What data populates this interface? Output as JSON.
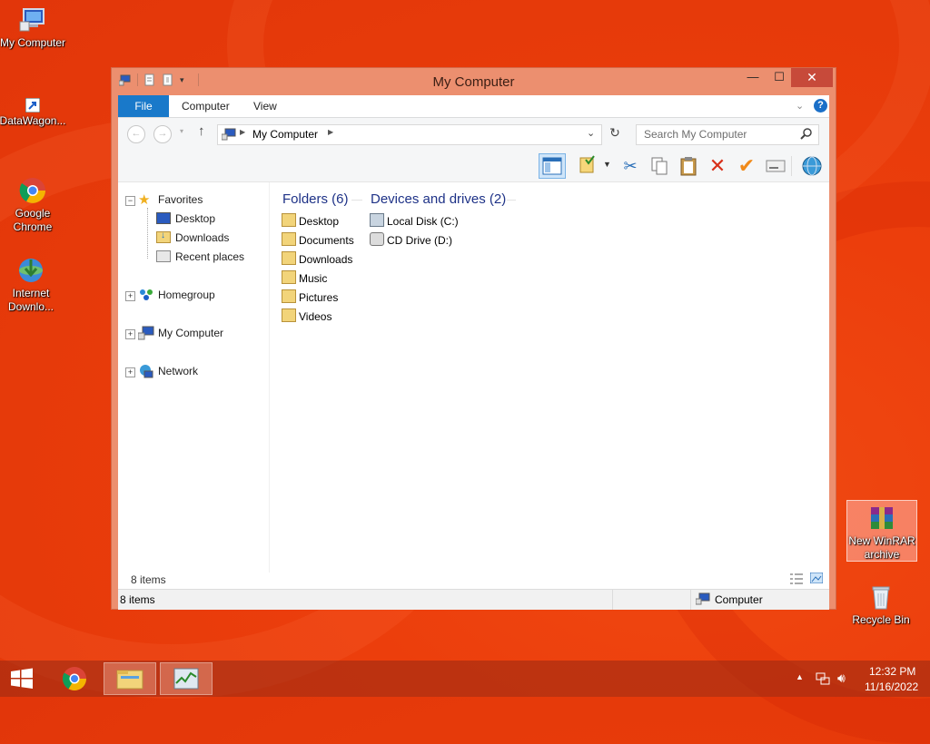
{
  "desktop": {
    "icons": [
      {
        "label": "My Computer"
      },
      {
        "label": "DataWagon..."
      },
      {
        "label": "Google Chrome"
      },
      {
        "label": "Internet Downlo..."
      },
      {
        "label": "New WinRAR archive"
      },
      {
        "label": "Recycle Bin"
      }
    ]
  },
  "window": {
    "title": "My Computer",
    "controls": {
      "minimize": "—",
      "maximize": "☐",
      "close": "✕"
    },
    "ribbon_tabs": [
      "File",
      "Computer",
      "View"
    ],
    "address": {
      "path": "My Computer"
    },
    "search": {
      "placeholder": "Search My Computer"
    },
    "nav_pane": {
      "favorites": "Favorites",
      "favorites_items": [
        "Desktop",
        "Downloads",
        "Recent places"
      ],
      "homegroup": "Homegroup",
      "my_computer": "My Computer",
      "network": "Network"
    },
    "groups": {
      "folders_title": "Folders (6)",
      "folders": [
        "Desktop",
        "Documents",
        "Downloads",
        "Music",
        "Pictures",
        "Videos"
      ],
      "drives_title": "Devices and drives (2)",
      "drives": [
        "Local Disk (C:)",
        "CD Drive (D:)"
      ]
    },
    "item_count": "8 items",
    "status": {
      "left": "8 items",
      "right": "Computer"
    }
  },
  "taskbar": {
    "time": "12:32 PM",
    "date": "11/16/2022"
  },
  "colors": {
    "desktop": "#e8400e",
    "window_frame": "#ec8f6f",
    "file_tab": "#1979ca",
    "group_title": "#1e3287"
  }
}
